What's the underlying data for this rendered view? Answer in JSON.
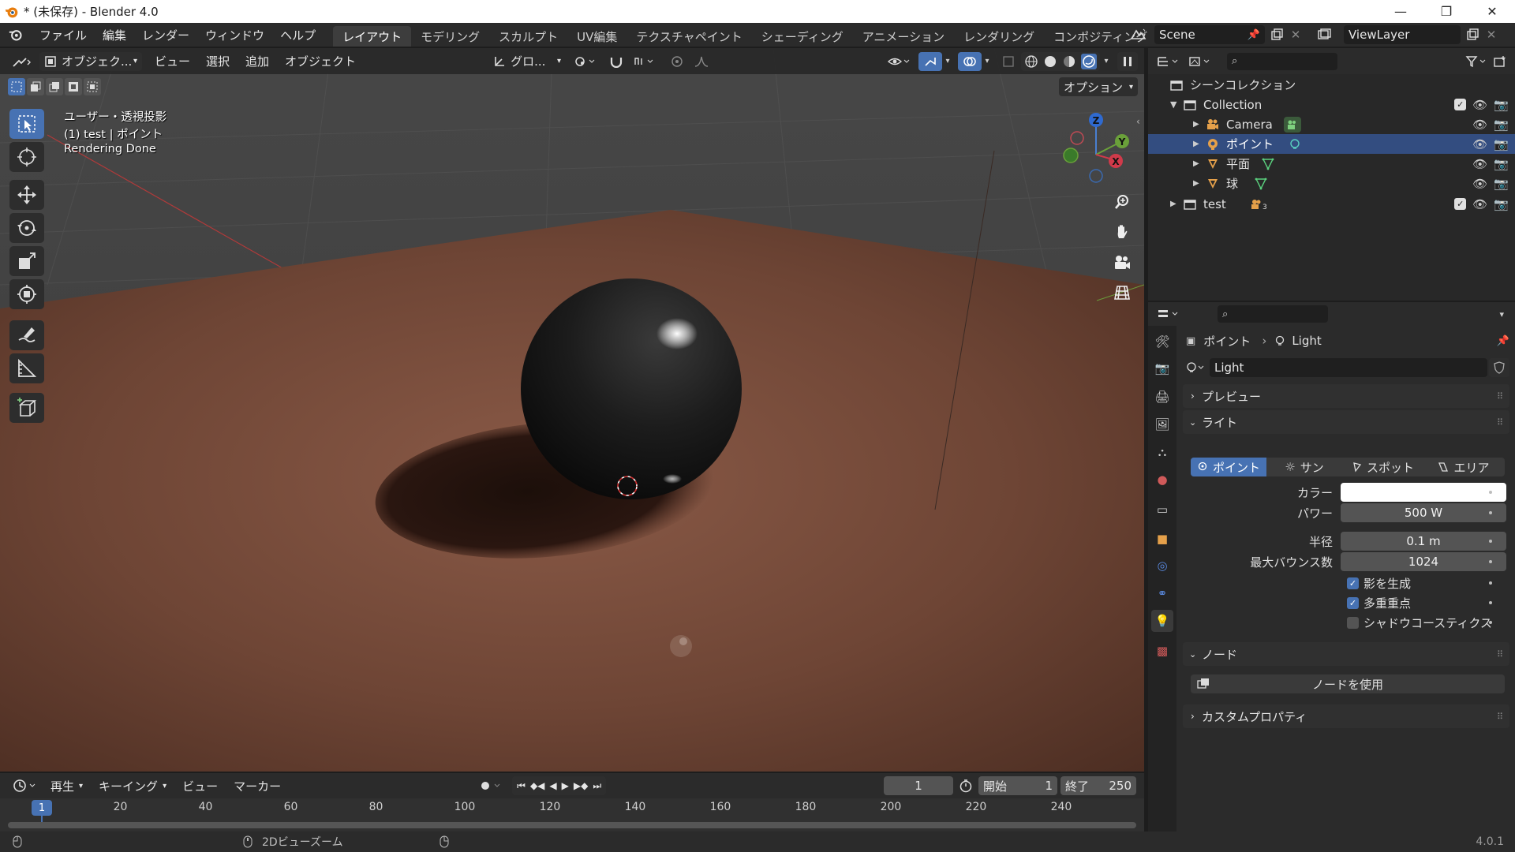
{
  "window": {
    "title": "* (未保存) - Blender 4.0",
    "minimize": "—",
    "maximize": "❐",
    "close": "✕"
  },
  "menu": [
    "ファイル",
    "編集",
    "レンダー",
    "ウィンドウ",
    "ヘルプ"
  ],
  "workspaces": [
    "レイアウト",
    "モデリング",
    "スカルプト",
    "UV編集",
    "テクスチャペイント",
    "シェーディング",
    "アニメーション",
    "レンダリング",
    "コンポジティング"
  ],
  "active_workspace": "レイアウト",
  "scene": {
    "name": "Scene",
    "view_layer": "ViewLayer"
  },
  "viewport_header": {
    "mode": "オブジェク...",
    "view": "ビュー",
    "select": "選択",
    "add": "追加",
    "object": "オブジェクト",
    "transform": "グロ...",
    "options": "オプション"
  },
  "viewport_overlay": {
    "line1": "ユーザー・透視投影",
    "line2": "(1) test | ポイント",
    "line3": "Rendering Done"
  },
  "gizmo": {
    "z": "Z",
    "y": "Y",
    "x": "X"
  },
  "outliner": {
    "root": "シーンコレクション",
    "items": [
      {
        "name": "Collection",
        "level": 1
      },
      {
        "name": "Camera",
        "level": 2
      },
      {
        "name": "ポイント",
        "level": 2,
        "selected": true
      },
      {
        "name": "平面",
        "level": 2
      },
      {
        "name": "球",
        "level": 2
      },
      {
        "name": "test",
        "level": 1
      }
    ],
    "test_badge": "3"
  },
  "properties": {
    "breadcrumb_object": "ポイント",
    "breadcrumb_data": "Light",
    "datablock": "Light",
    "panels": {
      "preview": "プレビュー",
      "light": "ライト",
      "nodes": "ノード",
      "custom": "カスタムプロパティ"
    },
    "light_types": [
      "ポイント",
      "サン",
      "スポット",
      "エリア"
    ],
    "fields": {
      "color_label": "カラー",
      "power_label": "パワー",
      "power": "500 W",
      "radius_label": "半径",
      "radius": "0.1 m",
      "bounces_label": "最大バウンス数",
      "bounces": "1024"
    },
    "checks": [
      {
        "label": "影を生成",
        "checked": true
      },
      {
        "label": "多重重点",
        "checked": true
      },
      {
        "label": "シャドウコースティクス",
        "checked": false
      }
    ],
    "use_nodes": "ノードを使用"
  },
  "timeline": {
    "menu": [
      "再生",
      "キーイング",
      "ビュー",
      "マーカー"
    ],
    "current_frame": "1",
    "start_label": "開始",
    "start": "1",
    "end_label": "終了",
    "end": "250",
    "ticks": [
      "20",
      "40",
      "60",
      "80",
      "100",
      "120",
      "140",
      "160",
      "180",
      "200",
      "220",
      "240"
    ],
    "playhead": "1"
  },
  "status": {
    "hint": "2Dビューズーム",
    "version": "4.0.1"
  },
  "colors": {
    "accent": "#4772b3",
    "selected_row": "#334d80",
    "floor": "#6b4535"
  }
}
